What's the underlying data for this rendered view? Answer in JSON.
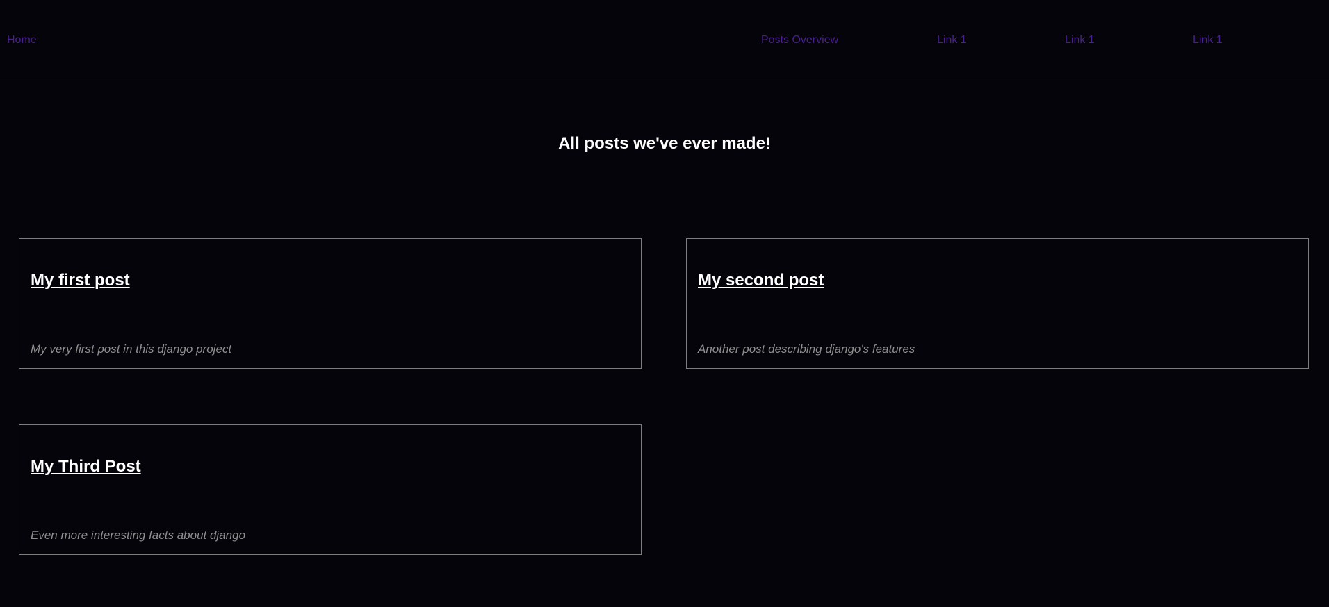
{
  "nav": {
    "home": "Home",
    "posts_overview": "Posts Overview",
    "links": [
      "Link 1",
      "Link 1",
      "Link 1"
    ]
  },
  "page": {
    "title": "All posts we've ever made!"
  },
  "posts": [
    {
      "title": "My first post",
      "excerpt": "My very first post in this django project"
    },
    {
      "title": "My second post",
      "excerpt": "Another post describing django's features"
    },
    {
      "title": "My Third Post",
      "excerpt": "Even more interesting facts about django"
    }
  ],
  "colors": {
    "background": "#04040a",
    "nav_link": "#4b1f8f",
    "border": "#7d7d7d",
    "excerpt": "#8f8f8f",
    "heading": "#ffffff"
  }
}
